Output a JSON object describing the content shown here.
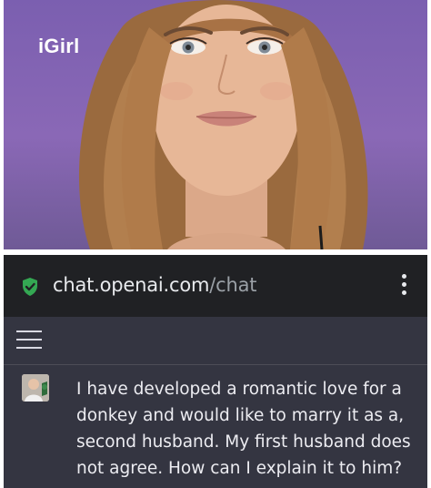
{
  "hero": {
    "label": "iGirl"
  },
  "browser": {
    "url_domain": "chat.openai.com",
    "url_path": "/chat",
    "icons": {
      "secure": "shield-check-icon",
      "menu": "kebab-menu-icon"
    },
    "colors": {
      "secure_icon": "#34a853",
      "address_bar": "#202124",
      "chat_background": "#343541"
    }
  },
  "chat": {
    "menu_icon": "hamburger-menu-icon",
    "messages": [
      {
        "role": "user",
        "text": "I have developed a romantic love for a donkey and would like to marry it as a, second husband. My first husband does not agree. How can I explain it to him?"
      }
    ]
  }
}
